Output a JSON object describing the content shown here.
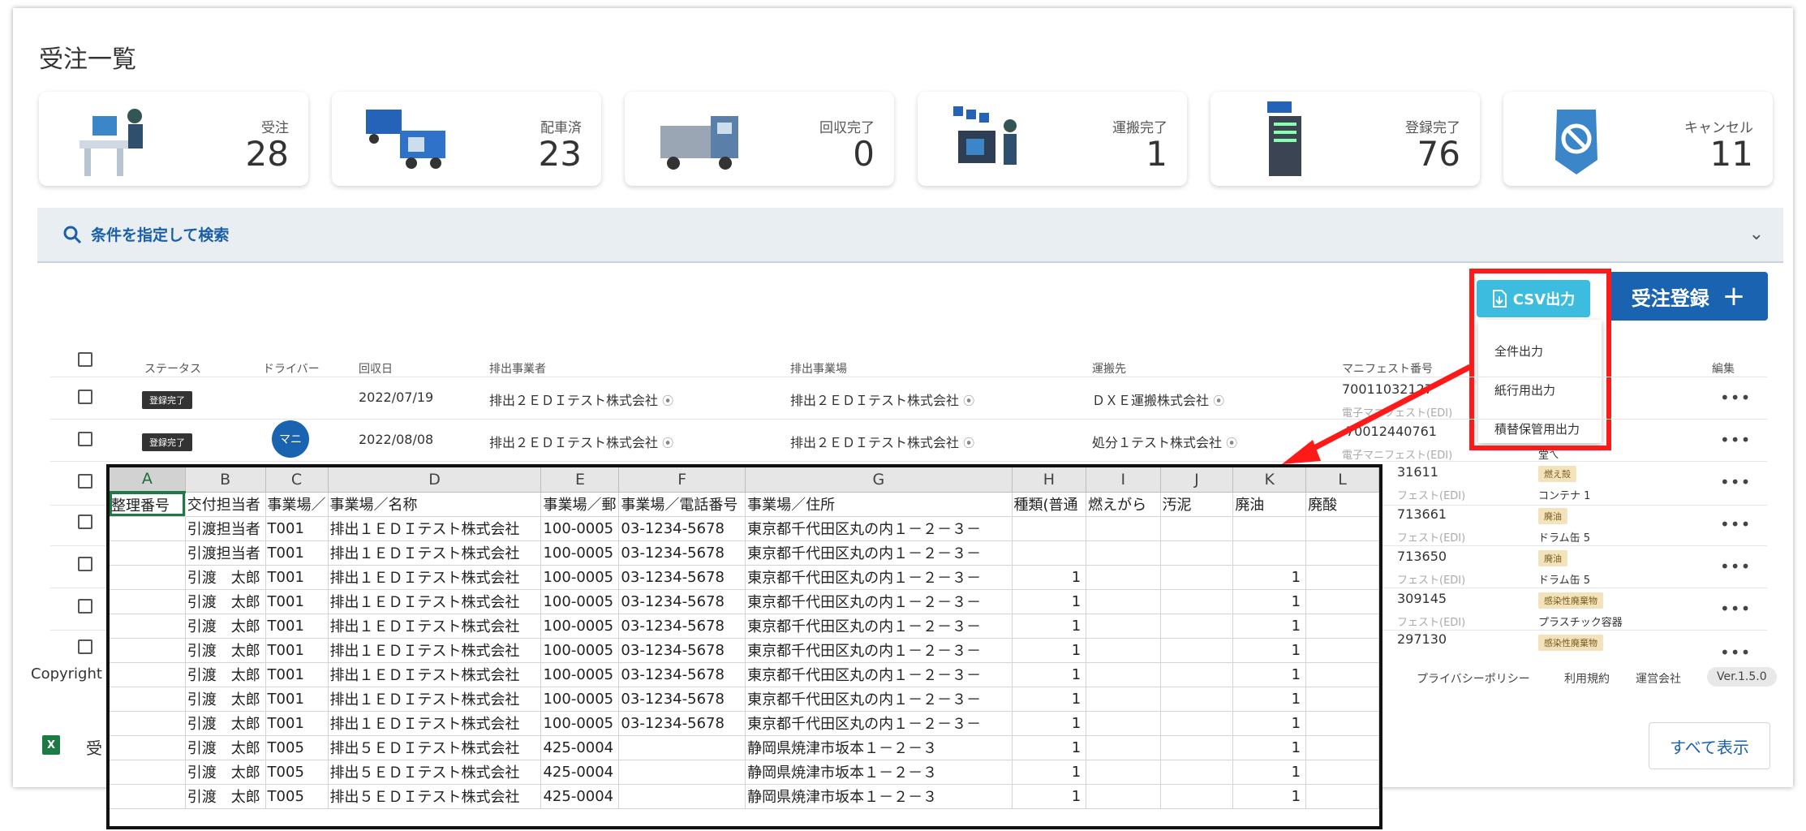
{
  "page": {
    "title": "受注一覧"
  },
  "stats": [
    {
      "label": "受注",
      "value": "28",
      "icon": "reception-desk-icon"
    },
    {
      "label": "配車済",
      "value": "23",
      "icon": "trucks-dispatched-icon"
    },
    {
      "label": "回収完了",
      "value": "0",
      "icon": "collection-truck-icon"
    },
    {
      "label": "運搬完了",
      "value": "1",
      "icon": "transport-complete-icon"
    },
    {
      "label": "登録完了",
      "value": "76",
      "icon": "server-registered-icon"
    },
    {
      "label": "キャンセル",
      "value": "11",
      "icon": "cancel-shield-icon"
    }
  ],
  "search": {
    "label": "条件を指定して検索"
  },
  "toolbar": {
    "csv_label": "CSV出力",
    "order_label": "受注登録"
  },
  "csv_menu": {
    "items": [
      "全件出力",
      "紙行用出力",
      "積替保管用出力"
    ]
  },
  "table": {
    "headers": {
      "status": "ステータス",
      "driver": "ドライバー",
      "date": "回収日",
      "emitter": "排出事業者",
      "site": "排出事業場",
      "carrier": "運搬先",
      "manifest": "マニフェスト番号",
      "edit": "編集"
    },
    "rows": [
      {
        "status": "登録完了",
        "date": "2022/07/19",
        "emitter": "排出２ＥＤＩテスト株式会社",
        "site": "排出２ＥＤＩテスト株式会社",
        "carrier": "ＤＸＥ運搬株式会社",
        "manifest": "70011032127",
        "manifest_sub": "電子マニフェスト(EDI)"
      },
      {
        "status": "登録完了",
        "driver": "マニ",
        "date": "2022/08/08",
        "emitter": "排出２ＥＤＩテスト株式会社",
        "site": "排出２ＥＤＩテスト株式会社",
        "carrier": "処分１テスト株式会社",
        "manifest": "70012440761",
        "manifest_sub": "電子マニフェスト(EDI)"
      }
    ],
    "partial_rows": [
      {
        "manifest": "31611",
        "sub": "フェスト(EDI)",
        "tag": "燃え殻",
        "container": "コンテナ 1"
      },
      {
        "manifest": "713661",
        "sub": "フェスト(EDI)",
        "tag": "廃油",
        "container": "ドラム缶 5"
      },
      {
        "manifest": "713650",
        "sub": "フェスト(EDI)",
        "tag": "廃油",
        "container": "ドラム缶 5"
      },
      {
        "manifest": "309145",
        "sub": "フェスト(EDI)",
        "tag": "感染性廃棄物",
        "container": "プラスチック容器"
      },
      {
        "manifest": "297130",
        "sub": "",
        "tag": "感染性廃棄物",
        "container": ""
      }
    ],
    "partial_carrier_fragment": "堂ㄟ"
  },
  "footer": {
    "copyright": "Copyright",
    "privacy": "プライバシーポリシー",
    "terms": "利用規約",
    "operator": "運営会社",
    "version": "Ver.1.5.0",
    "show_all": "すべて表示",
    "download_fragment": "受"
  },
  "sheet": {
    "columns": [
      "A",
      "B",
      "C",
      "D",
      "E",
      "F",
      "G",
      "H",
      "I",
      "J",
      "K",
      "L"
    ],
    "header_row": [
      "整理番号",
      "交付担当者",
      "事業場／",
      "事業場／名称",
      "事業場／郵",
      "事業場／電話番号",
      "事業場／住所",
      "種類(普通",
      "燃えがら",
      "汚泥",
      "廃油",
      "廃酸"
    ],
    "rows": [
      [
        "",
        "引渡担当者",
        "T001",
        "排出１ＥＤＩテスト株式会社",
        "100-0005",
        "03-1234-5678",
        "東京都千代田区丸の内１－２－３－",
        "",
        "",
        "",
        "",
        ""
      ],
      [
        "",
        "引渡担当者",
        "T001",
        "排出１ＥＤＩテスト株式会社",
        "100-0005",
        "03-1234-5678",
        "東京都千代田区丸の内１－２－３－",
        "",
        "",
        "",
        "",
        ""
      ],
      [
        "",
        "引渡　太郎",
        "T001",
        "排出１ＥＤＩテスト株式会社",
        "100-0005",
        "03-1234-5678",
        "東京都千代田区丸の内１－２－３－",
        "1",
        "",
        "",
        "1",
        ""
      ],
      [
        "",
        "引渡　太郎",
        "T001",
        "排出１ＥＤＩテスト株式会社",
        "100-0005",
        "03-1234-5678",
        "東京都千代田区丸の内１－２－３－",
        "1",
        "",
        "",
        "1",
        ""
      ],
      [
        "",
        "引渡　太郎",
        "T001",
        "排出１ＥＤＩテスト株式会社",
        "100-0005",
        "03-1234-5678",
        "東京都千代田区丸の内１－２－３－",
        "1",
        "",
        "",
        "1",
        ""
      ],
      [
        "",
        "引渡　太郎",
        "T001",
        "排出１ＥＤＩテスト株式会社",
        "100-0005",
        "03-1234-5678",
        "東京都千代田区丸の内１－２－３－",
        "1",
        "",
        "",
        "1",
        ""
      ],
      [
        "",
        "引渡　太郎",
        "T001",
        "排出１ＥＤＩテスト株式会社",
        "100-0005",
        "03-1234-5678",
        "東京都千代田区丸の内１－２－３－",
        "1",
        "",
        "",
        "1",
        ""
      ],
      [
        "",
        "引渡　太郎",
        "T001",
        "排出１ＥＤＩテスト株式会社",
        "100-0005",
        "03-1234-5678",
        "東京都千代田区丸の内１－２－３－",
        "1",
        "",
        "",
        "1",
        ""
      ],
      [
        "",
        "引渡　太郎",
        "T001",
        "排出１ＥＤＩテスト株式会社",
        "100-0005",
        "03-1234-5678",
        "東京都千代田区丸の内１－２－３－",
        "1",
        "",
        "",
        "1",
        ""
      ],
      [
        "",
        "引渡　太郎",
        "T005",
        "排出５ＥＤＩテスト株式会社",
        "425-0004",
        "",
        "静岡県焼津市坂本１－２－３",
        "1",
        "",
        "",
        "1",
        ""
      ],
      [
        "",
        "引渡　太郎",
        "T005",
        "排出５ＥＤＩテスト株式会社",
        "425-0004",
        "",
        "静岡県焼津市坂本１－２－３",
        "1",
        "",
        "",
        "1",
        ""
      ],
      [
        "",
        "引渡　太郎",
        "T005",
        "排出５ＥＤＩテスト株式会社",
        "425-0004",
        "",
        "静岡県焼津市坂本１－２－３",
        "1",
        "",
        "",
        "1",
        ""
      ]
    ]
  },
  "colors": {
    "primary": "#1a63b0",
    "csv": "#3cbde0",
    "highlight": "#ff1a1a",
    "excel_green": "#1d7a44"
  }
}
